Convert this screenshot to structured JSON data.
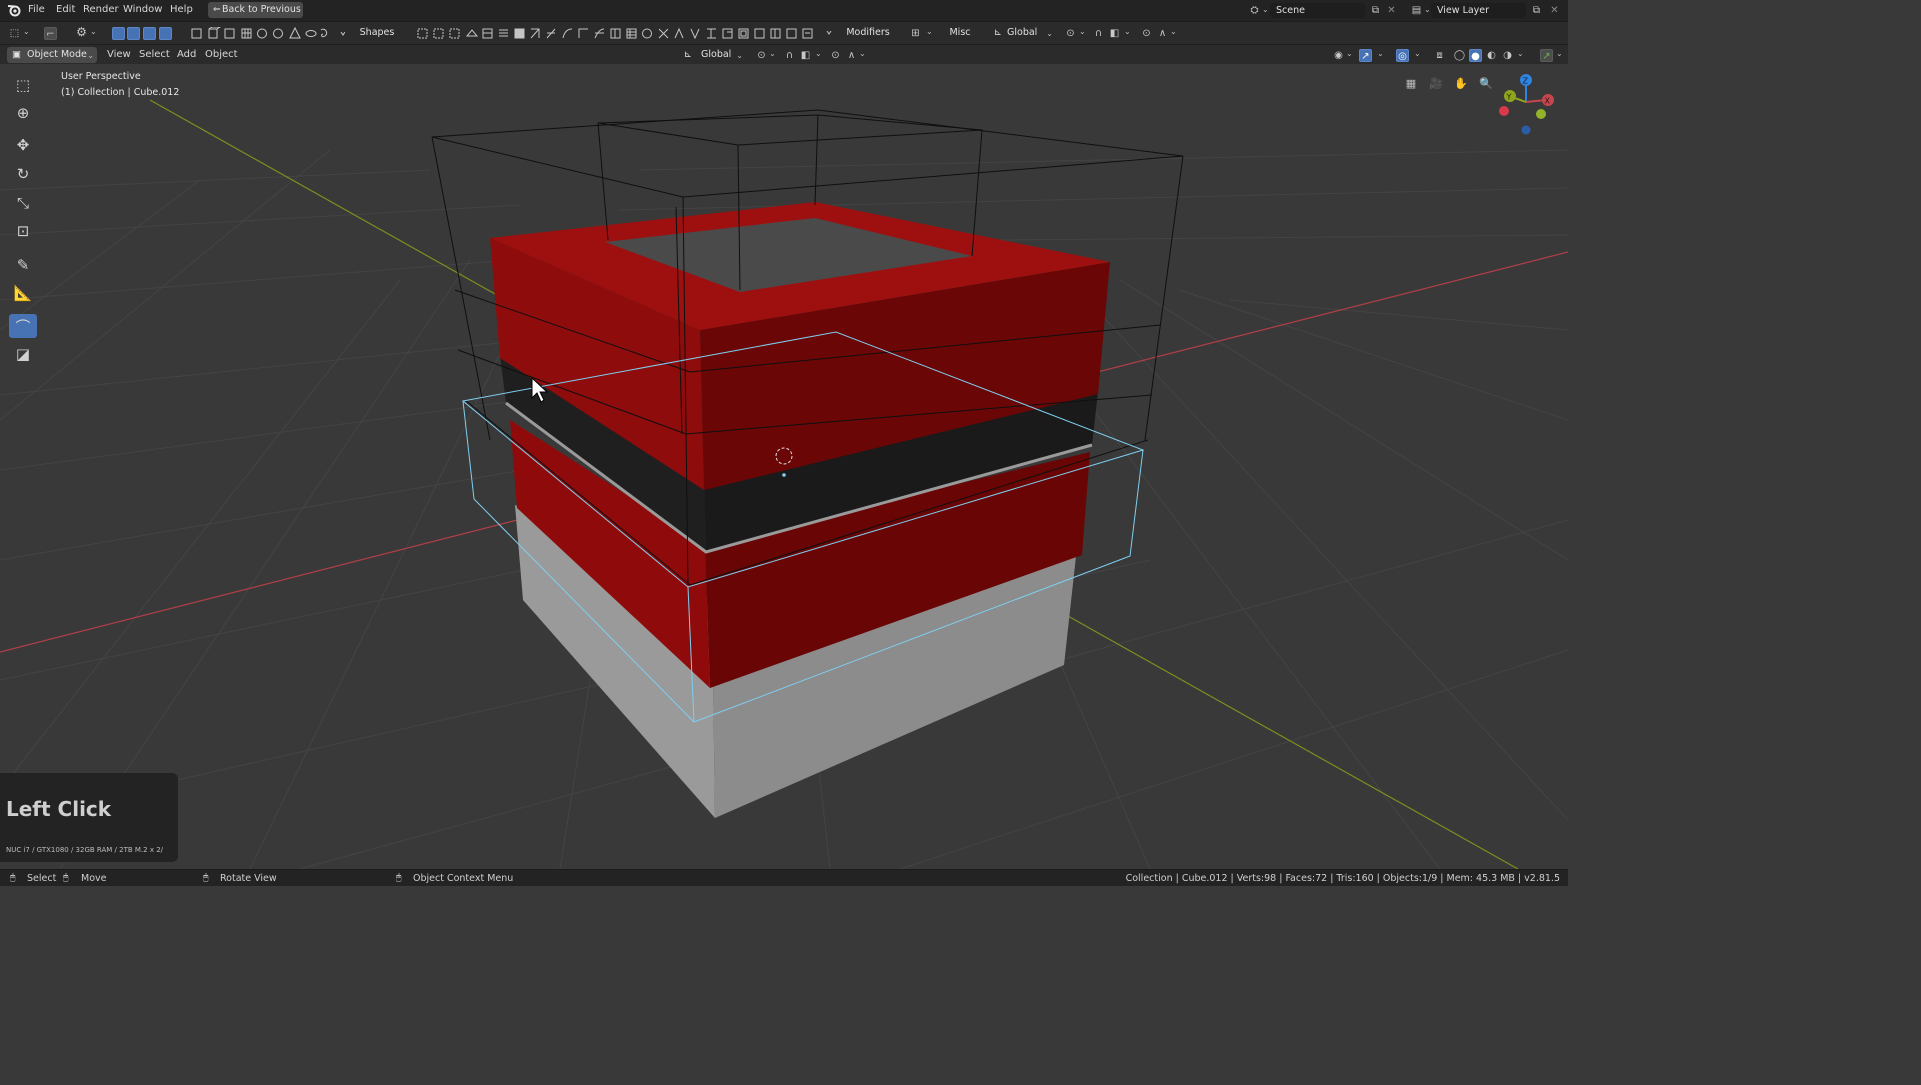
{
  "app": {
    "name": "Blender",
    "version": "v2.81.5"
  },
  "topbar": {
    "menus": [
      "File",
      "Edit",
      "Render",
      "Window",
      "Help"
    ],
    "back_button": "Back to Previous",
    "scene_label": "Scene",
    "view_layer_label": "View Layer"
  },
  "toolbar": {
    "shapes_label": "Shapes",
    "modifiers_label": "Modifiers",
    "misc_label": "Misc",
    "orientation": "Global"
  },
  "viewport_header": {
    "mode": "Object Mode",
    "menus": [
      "View",
      "Select",
      "Add",
      "Object"
    ],
    "orientation": "Global"
  },
  "viewport": {
    "perspective_label": "User Perspective",
    "active_object_label": "(1) Collection | Cube.012",
    "gizmo_axes": {
      "x": "X",
      "y": "Y",
      "z": "Z"
    }
  },
  "keycast": {
    "action": "Left Click",
    "specs": "NUC i7 / GTX1080 / 32GB RAM / 2TB M.2 x 2/"
  },
  "statusbar": {
    "select": "Select",
    "move": "Move",
    "rotate": "Rotate View",
    "context": "Object Context Menu",
    "stats": "Collection | Cube.012 | Verts:98 | Faces:72 | Tris:160 | Objects:1/9 | Mem: 45.3 MB | v2.81.5"
  },
  "colors": {
    "background": "#393939",
    "header": "#2b2b2b",
    "accent_blue": "#4772b3",
    "object_red": "#8b0c0c",
    "selection_outline": "#7fd0f0",
    "x_axis": "#c4474f",
    "y_axis": "#8ea51d",
    "z_axis": "#2f84e0"
  },
  "icons": [
    "blender-logo-icon",
    "back-icon",
    "select-box-icon",
    "cursor-icon",
    "move-icon",
    "rotate-icon",
    "scale-icon",
    "transform-icon",
    "annotate-icon",
    "measure-icon",
    "shear-icon",
    "add-cube-icon",
    "grid-icon",
    "camera-icon",
    "hand-icon",
    "zoom-icon",
    "mouse-icon"
  ]
}
